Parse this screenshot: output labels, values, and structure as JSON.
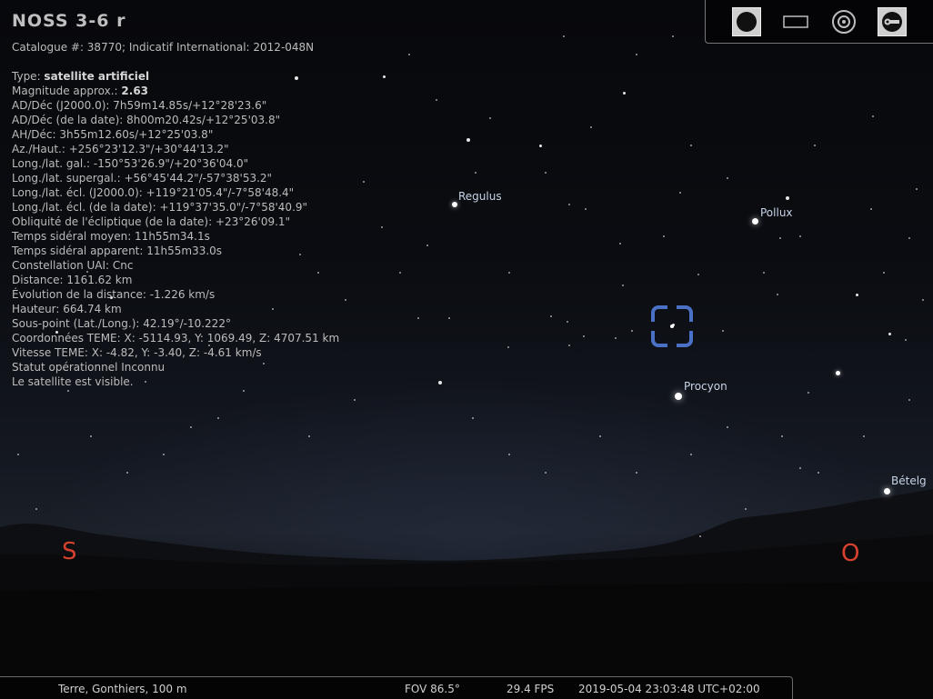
{
  "object": {
    "title": "NOSS 3-6 r",
    "catalogue_line": "Catalogue #: 38770; Indicatif International: 2012-048N",
    "type_label": "Type: ",
    "type_value": "satellite artificiel",
    "magnitude_label": "Magnitude approx.: ",
    "magnitude_value": "2.63",
    "lines": [
      "AD/Déc (J2000.0): 7h59m14.85s/+12°28'23.6\"",
      "AD/Déc (de la date): 8h00m20.42s/+12°25'03.8\"",
      "AH/Déc: 3h55m12.60s/+12°25'03.8\"",
      "Az./Haut.: +256°23'12.3\"/+30°44'13.2\"",
      "Long./lat. gal.: -150°53'26.9\"/+20°36'04.0\"",
      "Long./lat. supergal.: +56°45'44.2\"/-57°38'53.2\"",
      "Long./lat. écl. (J2000.0): +119°21'05.4\"/-7°58'48.4\"",
      "Long./lat. écl. (de la date): +119°37'35.0\"/-7°58'40.9\"",
      "Obliquité de l'écliptique (de la date): +23°26'09.1\"",
      "Temps sidéral moyen: 11h55m34.1s",
      "Temps sidéral apparent: 11h55m33.0s",
      "Constellation UAI: Cnc",
      "Distance: 1161.62 km",
      "Évolution de la distance: -1.226 km/s",
      "Hauteur: 664.74 km",
      "Sous-point (Lat./Long.): 42.19°/-10.222°",
      "Coordonnées TEME: X: -5114.93, Y: 1069.49, Z: 4707.51 km",
      "Vitesse TEME: X: -4.82, Y: -3.40, Z: -4.61 km/s",
      "Statut opérationnel Inconnu",
      "Le satellite est visible."
    ]
  },
  "star_labels": {
    "regulus": "Regulus",
    "pollux": "Pollux",
    "procyon": "Procyon",
    "betelgeuse": "Bételg"
  },
  "cardinals": {
    "south": "S",
    "west": "O"
  },
  "toolbar": {
    "icons": [
      "circle-view-icon",
      "rectangle-view-icon",
      "target-icon",
      "wrench-tool-icon"
    ]
  },
  "status": {
    "location": "Terre, Gonthiers, 100 m",
    "fov": "FOV 86.5°",
    "fps": "29.4 FPS",
    "datetime": "2019-05-04 23:03:48 UTC+02:00"
  },
  "colors": {
    "cardinal": "#d8412f",
    "reticle": "#4b71c6",
    "sky": "#07080b"
  }
}
